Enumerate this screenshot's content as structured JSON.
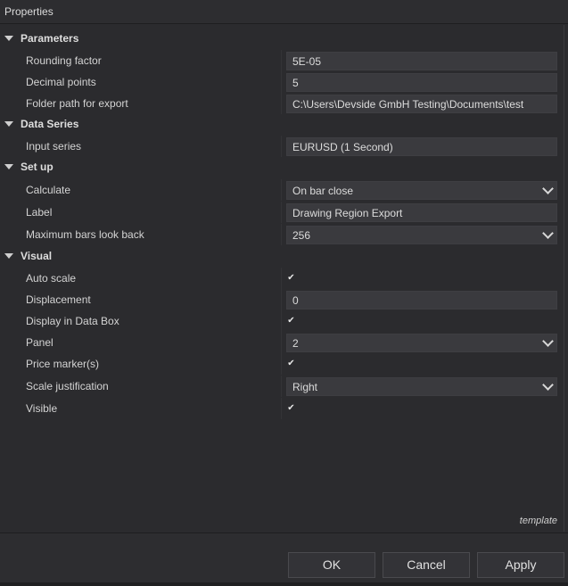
{
  "window": {
    "title": "Properties"
  },
  "sections": {
    "parameters": "Parameters",
    "data_series": "Data Series",
    "setup": "Set up",
    "visual": "Visual"
  },
  "rows": {
    "rounding_factor": {
      "label": "Rounding factor",
      "value": "5E-05"
    },
    "decimal_points": {
      "label": "Decimal points",
      "value": "5"
    },
    "folder_path": {
      "label": "Folder path for export",
      "value": "C:\\Users\\Devside GmbH Testing\\Documents\\test"
    },
    "input_series": {
      "label": "Input series",
      "value": "EURUSD (1 Second)"
    },
    "calculate": {
      "label": "Calculate",
      "value": "On bar close"
    },
    "label": {
      "label": "Label",
      "value": "Drawing Region Export"
    },
    "max_bars": {
      "label": "Maximum bars look back",
      "value": "256"
    },
    "auto_scale": {
      "label": "Auto scale",
      "checked": true
    },
    "displacement": {
      "label": "Displacement",
      "value": "0"
    },
    "display_data_box": {
      "label": "Display in Data Box",
      "checked": true
    },
    "panel": {
      "label": "Panel",
      "value": "2"
    },
    "price_markers": {
      "label": "Price marker(s)",
      "checked": true
    },
    "scale_justification": {
      "label": "Scale justification",
      "value": "Right"
    },
    "visible": {
      "label": "Visible",
      "checked": true
    }
  },
  "checkmark": "✔",
  "template_label": "template",
  "buttons": {
    "ok": "OK",
    "cancel": "Cancel",
    "apply": "Apply"
  }
}
